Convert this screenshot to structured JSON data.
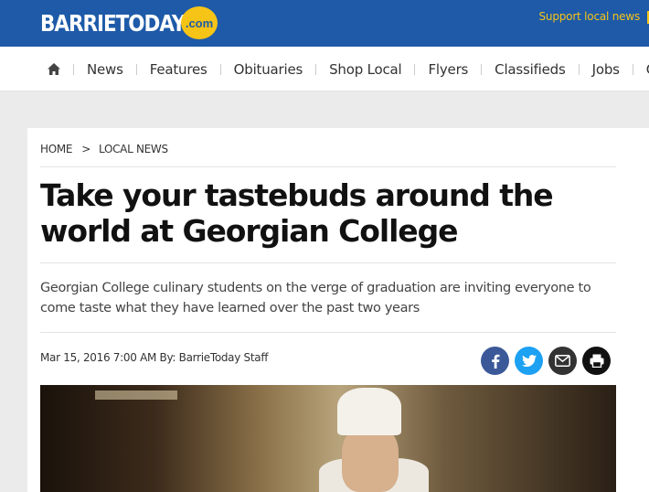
{
  "header": {
    "logo_text": "BARRIETODAY",
    "logo_badge": ".com",
    "support_link": "Support local news",
    "brand_color": "#1e5aa8",
    "accent_color": "#f6c416"
  },
  "nav": {
    "home_icon": "home-icon",
    "items": [
      "News",
      "Features",
      "Obituaries",
      "Shop Local",
      "Flyers",
      "Classifieds",
      "Jobs",
      "Co"
    ]
  },
  "article": {
    "breadcrumb": {
      "home": "HOME",
      "separator": ">",
      "section": "LOCAL NEWS"
    },
    "headline": "Take your tastebuds around the world at Georgian College",
    "dek": "Georgian College culinary students on the verge of graduation are inviting everyone to come taste what they have learned over the past two years",
    "byline": "Mar 15, 2016 7:00 AM By: BarrieToday Staff",
    "share": [
      {
        "icon": "facebook-icon",
        "color": "#3b5998"
      },
      {
        "icon": "twitter-icon",
        "color": "#1da1f2"
      },
      {
        "icon": "email-icon",
        "color": "#333333"
      },
      {
        "icon": "print-icon",
        "color": "#111111"
      }
    ]
  }
}
